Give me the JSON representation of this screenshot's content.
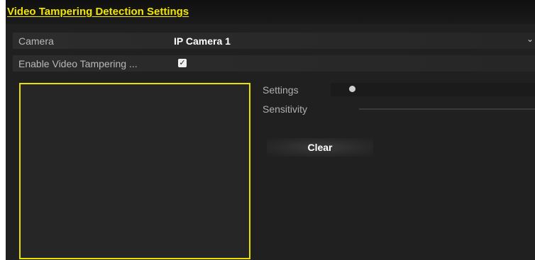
{
  "header": {
    "title": "Video Tampering Detection Settings"
  },
  "form": {
    "camera_label": "Camera",
    "camera_value": "IP Camera 1",
    "enable_label": "Enable Video Tampering ...",
    "enable_checked": true
  },
  "settings": {
    "settings_label": "Settings",
    "sensitivity_label": "Sensitivity"
  },
  "actions": {
    "clear_label": "Clear"
  },
  "colors": {
    "accent": "#f2e600",
    "background": "#202020",
    "area_border": "#e8e000"
  }
}
